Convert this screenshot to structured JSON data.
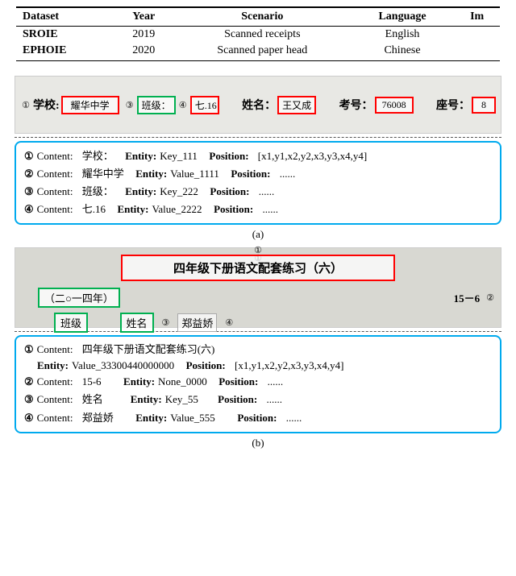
{
  "table": {
    "headers": [
      "Dataset",
      "Year",
      "Scenario",
      "Language",
      "Im"
    ],
    "rows": [
      {
        "dataset": "SROIE",
        "year": "2019",
        "scenario": "Scanned receipts",
        "language": "English",
        "im": ""
      },
      {
        "dataset": "EPHOIE",
        "year": "2020",
        "scenario": "Scanned paper head",
        "language": "Chinese",
        "im": ""
      }
    ]
  },
  "figure_a": {
    "scan": {
      "label1": "学校:",
      "box1_num": "①",
      "box1_val": "耀华中学",
      "label2_num": "③",
      "label2_box": "班级：",
      "box2_num": "④",
      "box2_val": "七.16",
      "label3": "姓名：",
      "box3_val": "王又成",
      "label4": "考号：",
      "box4_val": "76008",
      "label5": "座号：",
      "box5_val": "8"
    },
    "info": [
      {
        "num": "①",
        "content_label": "Content:",
        "content_val": "学校：",
        "entity_label": "Entity:",
        "entity_val": "Key_111",
        "pos_label": "Position:",
        "pos_val": "[x1,y1,x2,y2,x3,y3,x4,y4]"
      },
      {
        "num": "②",
        "content_label": "Content:",
        "content_val": "耀华中学",
        "entity_label": "Entity:",
        "entity_val": "Value_1111",
        "pos_label": "Position:",
        "pos_val": "......"
      },
      {
        "num": "③",
        "content_label": "Content:",
        "content_val": "班级：",
        "entity_label": "Entity:",
        "entity_val": "Key_222",
        "pos_label": "Position:",
        "pos_val": "......"
      },
      {
        "num": "④",
        "content_label": "Content:",
        "content_val": "七.16",
        "entity_label": "Entity:",
        "entity_val": "Value_2222",
        "pos_label": "Position:",
        "pos_val": "......"
      }
    ],
    "caption": "(a)"
  },
  "figure_b": {
    "scan": {
      "big_text": "四年级下册语文配套练习（六）",
      "circle1": "①",
      "green_box1": "（二○一四年）",
      "val_15_6": "15－6",
      "circle2": "②",
      "label_banji": "班级",
      "label_xingming": "姓名",
      "circle3": "③",
      "handwrite_val": "郑益娇",
      "circle4": "④"
    },
    "info": [
      {
        "num": "①",
        "content_label": "Content:",
        "content_val": "四年级下册语文配套练习(六)",
        "entity_label": "Entity:",
        "entity_val": "Value_33300440000000",
        "pos_label": "Position:",
        "pos_val": "[x1,y1,x2,y2,x3,y3,x4,y4]",
        "indent": false
      },
      {
        "num": "②",
        "content_label": "Content:",
        "content_val": "15-6",
        "entity_label": "Entity:",
        "entity_val": "None_0000",
        "pos_label": "Position:",
        "pos_val": "......",
        "indent": true
      },
      {
        "num": "③",
        "content_label": "Content:",
        "content_val": "姓名",
        "entity_label": "Entity:",
        "entity_val": "Key_55",
        "pos_label": "Position:",
        "pos_val": "......",
        "indent": true
      },
      {
        "num": "④",
        "content_label": "Content:",
        "content_val": "郑益娇",
        "entity_label": "Entity:",
        "entity_val": "Value_555",
        "pos_label": "Position:",
        "pos_val": "......",
        "indent": true
      }
    ],
    "caption": "(b)"
  }
}
